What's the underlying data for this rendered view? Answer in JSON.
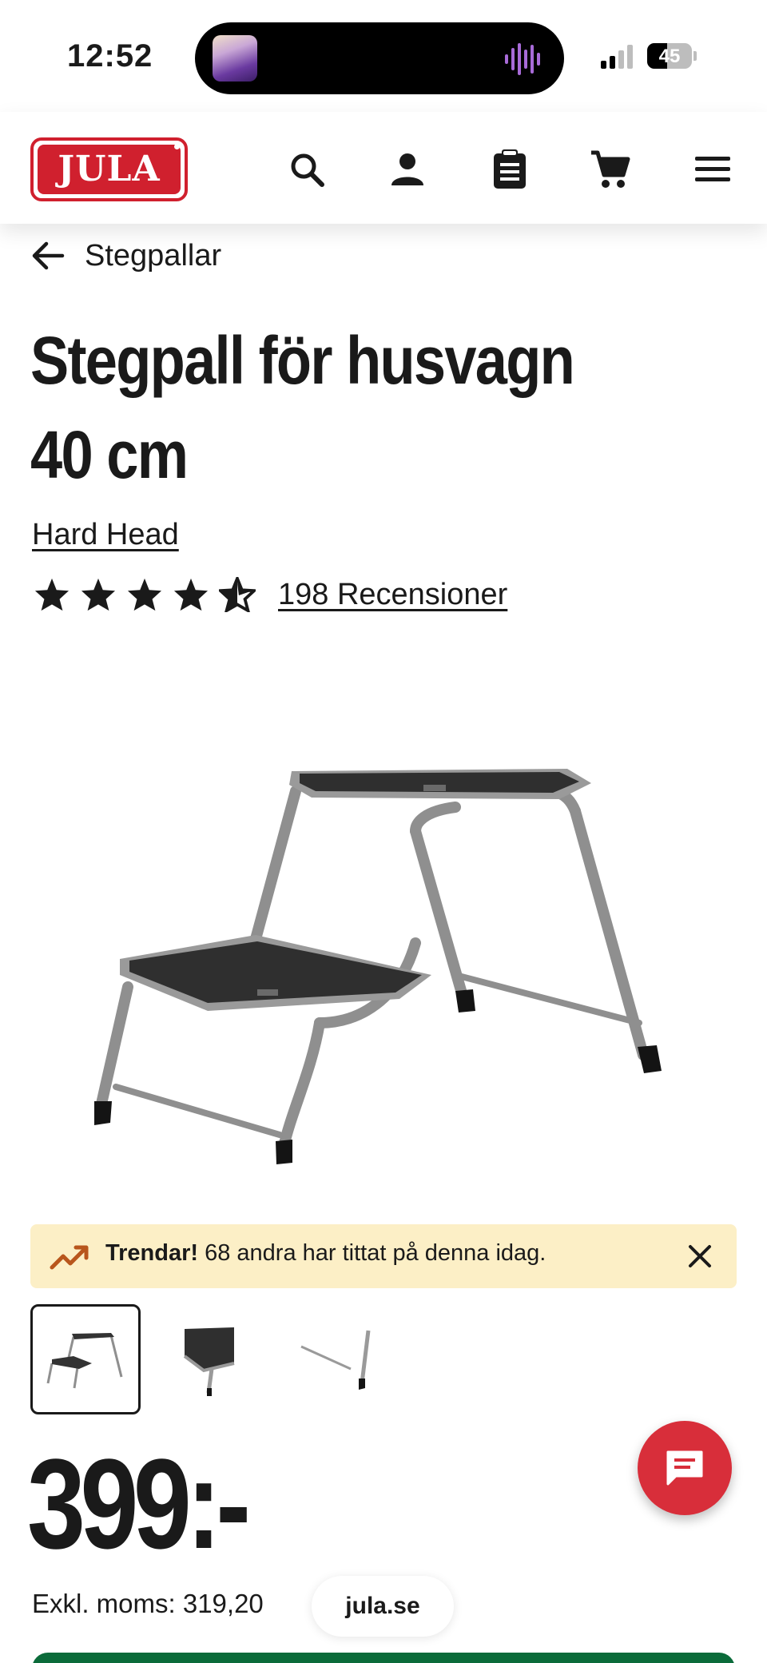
{
  "status_bar": {
    "time": "12:52",
    "battery": "45",
    "battery_level": 0.45
  },
  "header": {
    "logo_text": "JULA",
    "icons": [
      "search-icon",
      "account-icon",
      "clipboard-icon",
      "cart-icon",
      "menu-icon"
    ]
  },
  "breadcrumb": {
    "label": "Stegpallar"
  },
  "product": {
    "title": "Stegpall för husvagn 40 cm",
    "brand": "Hard Head",
    "rating": 4.5,
    "reviews": "198 Recensioner"
  },
  "trend": {
    "bold": "Trendar!",
    "text": " 68 andra har tittat på denna idag."
  },
  "thumbnails": [
    "full-view",
    "step-closeup",
    "leg-closeup"
  ],
  "price": {
    "value": "399:-",
    "ex_vat": "Exkl. moms: 319,20"
  },
  "browser": {
    "url": "jula.se"
  },
  "colors": {
    "brand_red": "#d0202e",
    "trend_bg": "#fcefc6",
    "chat_red": "#d82e3a",
    "cta_green": "#0b6b3a"
  }
}
